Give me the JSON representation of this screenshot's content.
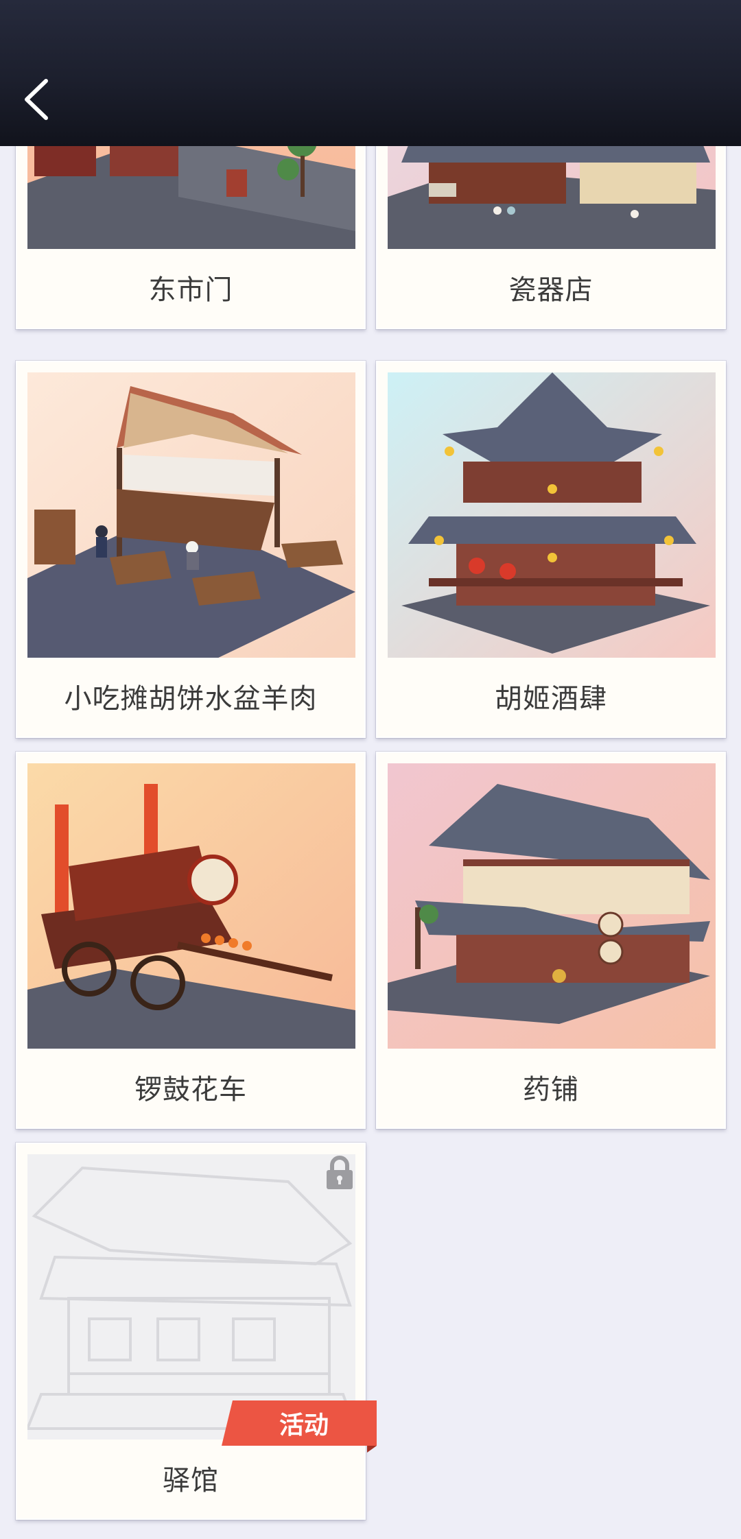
{
  "header": {
    "back_icon": "chevron-left-icon"
  },
  "items": [
    {
      "label": "东市门"
    },
    {
      "label": "瓷器店"
    },
    {
      "label": "小吃摊胡饼水盆羊肉"
    },
    {
      "label": "胡姬酒肆"
    },
    {
      "label": "锣鼓花车"
    },
    {
      "label": "药铺"
    },
    {
      "label": "驿馆",
      "locked": true,
      "lock_icon": "lock-icon",
      "badge": "活动"
    }
  ],
  "colors": {
    "header": "#1c1f2d",
    "background": "#eeeef7",
    "card": "#fffdf8",
    "badge": "#ec5543"
  }
}
